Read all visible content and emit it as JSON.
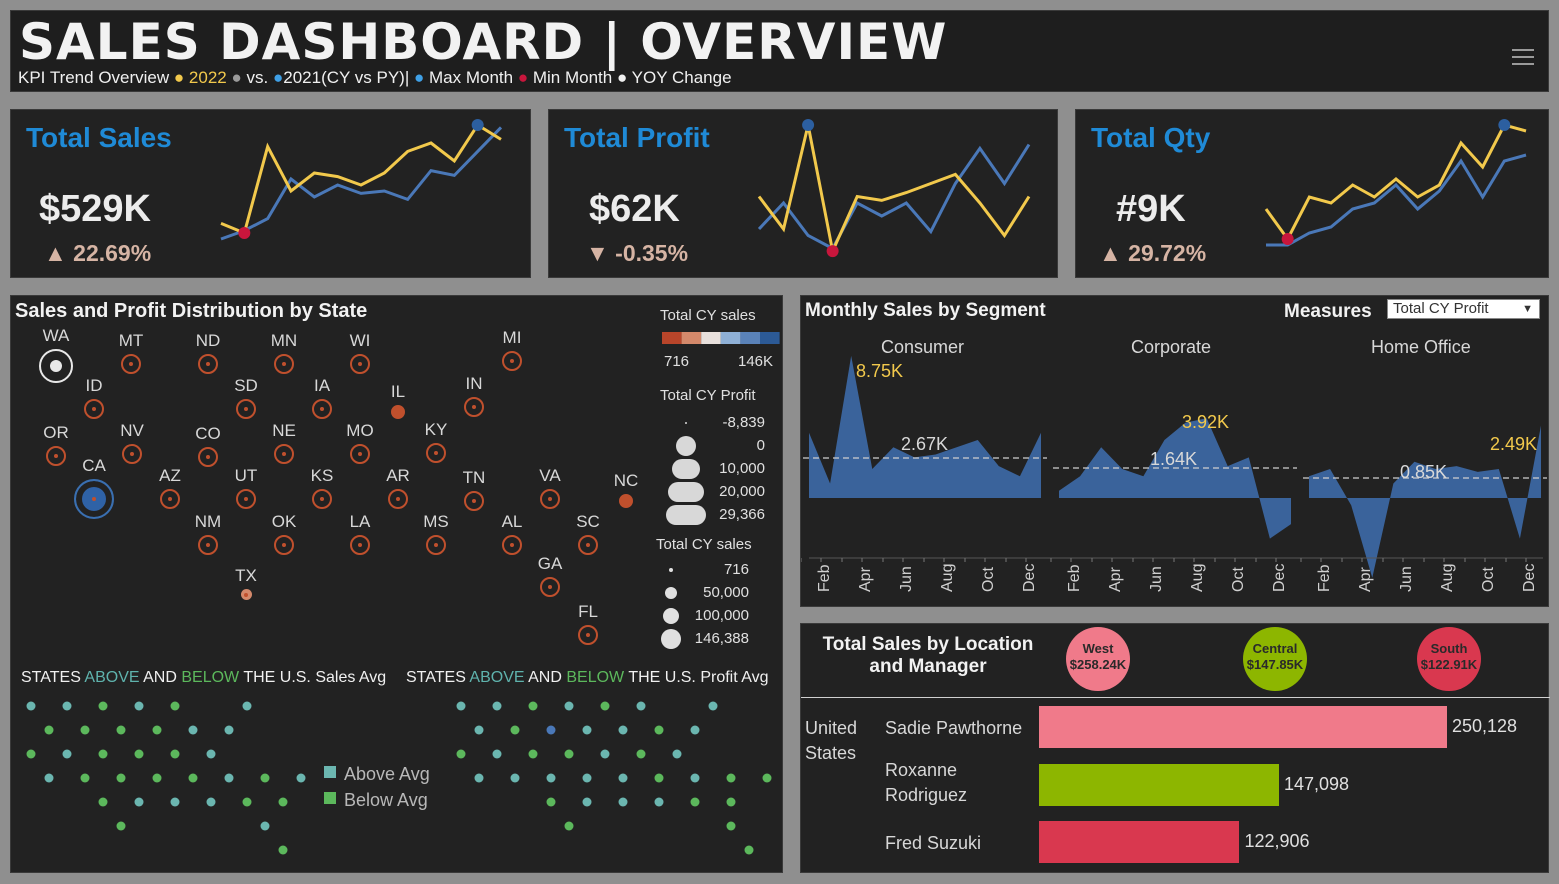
{
  "header": {
    "title": "SALES DASHBOARD | OVERVIEW",
    "subtitle_prefix": "KPI Trend Overview",
    "legend_cy": "2022",
    "legend_vs": "vs.",
    "legend_py": "2021(CY vs PY)|",
    "legend_max": "Max Month",
    "legend_min": "Min Month",
    "legend_yoy": "YOY Change",
    "bullet": "●",
    "menu_icon": "hamburger-icon"
  },
  "kpis": [
    {
      "title": "Total Sales",
      "value": "$529K",
      "arrow": "▲",
      "change": "22.69%",
      "cy": [
        0.18,
        0.1,
        0.82,
        0.45,
        0.6,
        0.57,
        0.5,
        0.6,
        0.78,
        0.85,
        0.7,
        1.0,
        0.88
      ],
      "py": [
        0.05,
        0.12,
        0.22,
        0.55,
        0.4,
        0.5,
        0.43,
        0.45,
        0.38,
        0.62,
        0.58,
        0.78,
        0.98
      ],
      "max_idx": 11,
      "min_idx": 1
    },
    {
      "title": "Total Profit",
      "value": "$62K",
      "arrow": "▼",
      "change": "-0.35%",
      "cy": [
        0.45,
        0.2,
        1.0,
        0.03,
        0.45,
        0.42,
        0.48,
        0.55,
        0.62,
        0.4,
        0.15,
        0.45
      ],
      "py": [
        0.2,
        0.4,
        0.15,
        0.05,
        0.4,
        0.3,
        0.4,
        0.18,
        0.55,
        0.82,
        0.55,
        0.85
      ],
      "max_idx": 2,
      "min_idx": 3
    },
    {
      "title": "Total Qty",
      "value": "#9K",
      "arrow": "▲",
      "change": "29.72%",
      "cy": [
        0.3,
        0.05,
        0.4,
        0.35,
        0.5,
        0.4,
        0.55,
        0.4,
        0.5,
        0.85,
        0.65,
        1.0,
        0.95
      ],
      "py": [
        0.0,
        0.0,
        0.1,
        0.15,
        0.3,
        0.35,
        0.5,
        0.3,
        0.45,
        0.7,
        0.4,
        0.7,
        0.75
      ],
      "max_idx": 11,
      "min_idx": 1
    }
  ],
  "map_section": {
    "title": "Sales and Profit Distribution by State",
    "legend_sales_title": "Total CY sales",
    "legend_sales_min": "716",
    "legend_sales_max": "146K",
    "legend_profit_title": "Total CY Profit",
    "legend_profit_values": [
      "-8,839",
      "0",
      "10,000",
      "20,000",
      "29,366"
    ],
    "legend_size_title": "Total CY sales",
    "legend_size_values": [
      "716",
      "50,000",
      "100,000",
      "146,388"
    ],
    "states": [
      "WA",
      "MT",
      "ND",
      "MN",
      "WI",
      "MI",
      "ID",
      "SD",
      "IA",
      "IL",
      "IN",
      "OR",
      "NV",
      "CO",
      "NE",
      "MO",
      "KY",
      "CA",
      "AZ",
      "UT",
      "KS",
      "AR",
      "TN",
      "VA",
      "NC",
      "NM",
      "OK",
      "LA",
      "MS",
      "AL",
      "SC",
      "TX",
      "GA",
      "FL"
    ],
    "palette_diverging": [
      "#b8452a",
      "#d4896b",
      "#e8e0dc",
      "#8fb0d6",
      "#5a82b8",
      "#2c5a96"
    ]
  },
  "avg_section": {
    "sales_title_a": "STATES ",
    "sales_title_above": "ABOVE",
    "sales_title_and": " AND ",
    "sales_title_below": "BELOW",
    "sales_title_end": " THE U.S. Sales Avg",
    "profit_title_end": " THE U.S. Profit Avg",
    "legend_above": "Above Avg",
    "legend_below": "Below Avg",
    "color_above": "#6bb6b0",
    "color_below": "#5cb85c"
  },
  "segment_section": {
    "title": "Monthly Sales by Segment",
    "measures_label": "Measures",
    "measures_value": "Total CY Profit",
    "segments": [
      {
        "name": "Consumer",
        "max_label": "8.75K",
        "avg_label": "2.67K",
        "values": [
          0.45,
          0.1,
          0.98,
          0.2,
          0.35,
          0.28,
          0.3,
          0.35,
          0.4,
          0.22,
          0.15,
          0.45
        ]
      },
      {
        "name": "Corporate",
        "max_label": "3.92K",
        "avg_label": "1.64K",
        "values": [
          0.05,
          0.15,
          0.35,
          0.2,
          0.15,
          0.4,
          0.52,
          0.55,
          0.22,
          0.28,
          -0.28,
          -0.18
        ]
      },
      {
        "name": "Home Office",
        "max_label": "2.49K",
        "avg_label": "0.85K",
        "values": [
          0.15,
          0.2,
          -0.05,
          -0.55,
          0.1,
          0.25,
          0.2,
          0.22,
          0.18,
          0.2,
          -0.28,
          0.5
        ]
      }
    ],
    "months": [
      "Feb",
      "Apr",
      "Jun",
      "Aug",
      "Oct",
      "Dec"
    ]
  },
  "location_section": {
    "title_line1": "Total Sales by Location",
    "title_line2": "and  Manager",
    "regions": [
      {
        "name": "West",
        "value": "$258.24K",
        "color": "#f07a8a"
      },
      {
        "name": "Central",
        "value": "$147.85K",
        "color": "#8db600"
      },
      {
        "name": "South",
        "value": "$122.91K",
        "color": "#d9384f"
      }
    ],
    "country_line1": "United",
    "country_line2": "States",
    "managers": [
      {
        "name_line1": "Sadie Pawthorne",
        "name_line2": "",
        "value": 250128,
        "label": "250,128",
        "color": "#f07a8a"
      },
      {
        "name_line1": "Roxanne",
        "name_line2": "Rodriguez",
        "value": 147098,
        "label": "147,098",
        "color": "#8db600"
      },
      {
        "name_line1": "Fred Suzuki",
        "name_line2": "",
        "value": 122906,
        "label": "122,906",
        "color": "#d9384f"
      }
    ]
  }
}
